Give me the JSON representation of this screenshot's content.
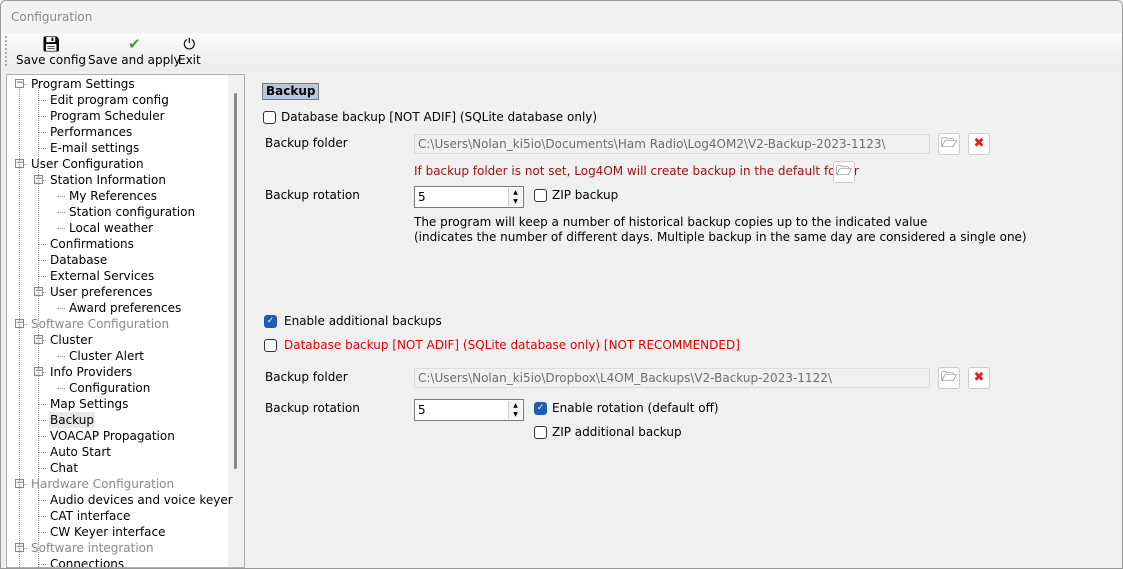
{
  "window": {
    "title": "Configuration"
  },
  "toolbar": {
    "save_config": "Save config",
    "save_apply": "Save and apply",
    "exit": "Exit"
  },
  "tree": [
    {
      "label": "Program Settings",
      "level": 0,
      "expander": true,
      "gray": false
    },
    {
      "label": "Edit program config",
      "level": 1
    },
    {
      "label": "Program Scheduler",
      "level": 1
    },
    {
      "label": "Performances",
      "level": 1
    },
    {
      "label": "E-mail settings",
      "level": 1
    },
    {
      "label": "User Configuration",
      "level": 0,
      "expander": true
    },
    {
      "label": "Station Information",
      "level": 1,
      "expander": true
    },
    {
      "label": "My References",
      "level": 2
    },
    {
      "label": "Station configuration",
      "level": 2
    },
    {
      "label": "Local weather",
      "level": 2
    },
    {
      "label": "Confirmations",
      "level": 1
    },
    {
      "label": "Database",
      "level": 1
    },
    {
      "label": "External Services",
      "level": 1
    },
    {
      "label": "User preferences",
      "level": 1,
      "expander": true
    },
    {
      "label": "Award preferences",
      "level": 2
    },
    {
      "label": "Software Configuration",
      "level": 0,
      "expander": true,
      "gray": true
    },
    {
      "label": "Cluster",
      "level": 1,
      "expander": true
    },
    {
      "label": "Cluster Alert",
      "level": 2
    },
    {
      "label": "Info Providers",
      "level": 1,
      "expander": true
    },
    {
      "label": "Configuration",
      "level": 2
    },
    {
      "label": "Map Settings",
      "level": 1
    },
    {
      "label": "Backup",
      "level": 1,
      "selected": true
    },
    {
      "label": "VOACAP Propagation",
      "level": 1
    },
    {
      "label": "Auto Start",
      "level": 1
    },
    {
      "label": "Chat",
      "level": 1
    },
    {
      "label": "Hardware Configuration",
      "level": 0,
      "expander": true,
      "gray": true
    },
    {
      "label": "Audio devices and voice keyer",
      "level": 1
    },
    {
      "label": "CAT interface",
      "level": 1
    },
    {
      "label": "CW Keyer interface",
      "level": 1
    },
    {
      "label": "Software integration",
      "level": 0,
      "expander": true,
      "gray": true
    },
    {
      "label": "Connections",
      "level": 1
    }
  ],
  "main": {
    "section_title": "Backup",
    "db_backup": {
      "label": "Database backup [NOT ADIF] (SQLite database only)",
      "checked": false
    },
    "backup_folder_label": "Backup folder",
    "backup_folder": "C:\\Users\\Nolan_ki5io\\Documents\\Ham Radio\\Log4OM2\\V2-Backup-2023-1123\\",
    "default_folder_note": "If backup folder is not set, Log4OM will create backup in the default folder",
    "rotation_label": "Backup rotation",
    "rotation": "5",
    "zip_backup": {
      "label": "ZIP backup",
      "checked": false
    },
    "info_line1": "The program will keep a number of historical backup copies up to the indicated value",
    "info_line2": "(indicates the number of different days. Multiple backup in the same day are considered a single one)",
    "additional": {
      "enable": {
        "label": "Enable additional backups",
        "checked": true
      },
      "db_backup": {
        "label": "Database backup [NOT ADIF] (SQLite database only) [NOT RECOMMENDED]",
        "checked": false
      },
      "folder_label": "Backup folder",
      "folder": "C:\\Users\\Nolan_ki5io\\Dropbox\\L4OM_Backups\\V2-Backup-2023-1122\\",
      "rotation_label": "Backup rotation",
      "rotation": "5",
      "enable_rotation": {
        "label": "Enable rotation (default off)",
        "checked": true
      },
      "zip": {
        "label": "ZIP additional backup",
        "checked": false
      }
    }
  }
}
